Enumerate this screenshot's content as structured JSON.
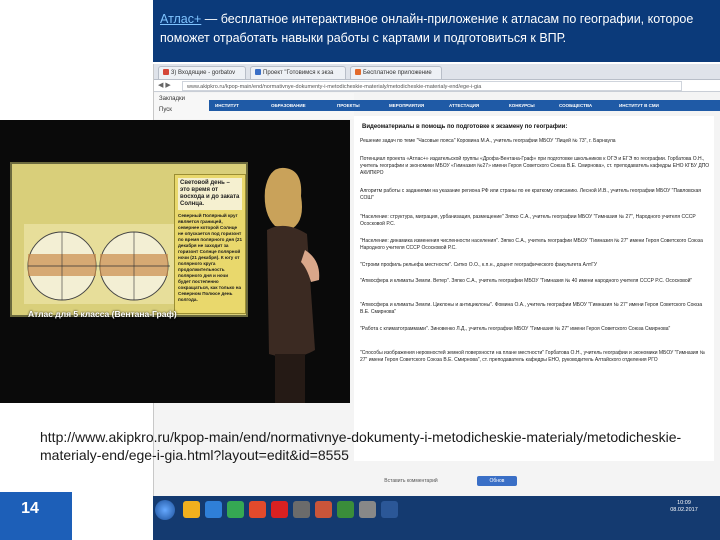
{
  "slide": {
    "header_link": "Атлас+",
    "header_text": " — бесплатное интерактивное онлайн-приложение к атласам по географии, которое поможет отработать навыки работы с картами и подготовиться к ВПР.",
    "slide_number": "14",
    "caption_url": "http://www.akipkro.ru/kpop-main/end/normativnye-dokumenty-i-metodicheskie-materialy/metodicheskie-materialy-end/ege-i-gia.html?layout=edit&id=8555",
    "colors": {
      "header_bg": "#0b3a7a",
      "link": "#7fc3ff",
      "accent": "#1d5fb8"
    }
  },
  "browser": {
    "tabs": [
      {
        "label": "3) Входящие - gorbatov",
        "fav_color": "#d44638"
      },
      {
        "label": "Проект \"Готовимся к экза",
        "fav_color": "#3a6fc6"
      },
      {
        "label": "Бесплатное приложение",
        "fav_color": "#e36b2c"
      }
    ],
    "url": "www.akipkro.ru/kpop-main/end/normativnye-dokumenty-i-metodicheskie-materialy/metodicheskie-materialy-end/ege-i-gia",
    "bookmarks": [
      "Закладки",
      "Пуск"
    ],
    "nav_items": [
      "ИНСТИТУТ",
      "ОБРАЗОВАНИЕ",
      "ПРОЕКТЫ",
      "МЕРОПРИЯТИЯ",
      "АТТЕСТАЦИЯ",
      "КОНКУРСЫ",
      "СООБЩЕСТВА",
      "ИНСТИТУТ В СМИ"
    ],
    "content_heading": "Видеоматериалы в помощь по подготовке к экзамену по географии:",
    "references": [
      "Решение задач по теме \"Часовые пояса\" Коровина М.А., учитель географии МБОУ \"Лицей № 73\", г. Барнаула",
      "Потенциал проекта «Атлас+» издательской группы «Дрофа-Вентана-Граф» при подготовке школьников к ОГЭ и ЕГЭ по географии. Горбатова О.Н., учитель географии и экономики МБОУ «Гимназия №27» имени Героя Советского Союза В.Е. Смирнова», ст. преподаватель кафедры ЕНО КГБУ ДПО АКИПКРО",
      "Алгоритм работы с заданиями на указание региона РФ или страны по ее краткому описанию. Лесной И.В., учитель географии МБОУ \"Павловская СОШ\"",
      "\"Население: структура, миграция, урбанизация, размещение\" Зяпко С.А., учитель географии МБОУ \"Гимназия № 27\", Народного учителя СССР Ососковой Р.С.",
      "\"Население: динамика изменения численности населения\". Зяпко С.А., учитель географии МБОУ \"Гимназия № 27\" имени Героя Советского Союза Народного учителя СССР Ососковой Р.С.",
      "\"Строим профиль рельефа местности\". Ситко О.О., к.п.н., доцент географического факультета АлтГУ",
      "\"Атмосфера и климаты Земли. Ветер\". Зяпко С.А., учитель географии МБОУ \"Гимназия № 40 имени народного учителя СССР Р.С. Ососковой\"",
      "\"Атмосфера и климаты Земли. Циклоны и антициклоны\". Фомина О.А., учитель географии МБОУ \"Гимназия № 27\" имени Героя Советского Союза В.Е. Смирнова\"",
      "\"Работа с климатограммами\". Зиновенко Л.Д., учитель географии МБОУ \"Гимназия № 27\" имени Героя Советского Союза Смирнова\"",
      "\"Способы изображения неровностей земной поверхности на плане местности\" Горбатова О.Н., учитель географии и экономики МБОУ \"Гимназия № 27\" имени Героя Советского Союза В.Е. Смирнова\", ст. преподаватель кафедры ЕНО, руководитель Алтайского отделения РГО"
    ],
    "comment_label": "Вставить комментарий",
    "refresh_label": "Обнов"
  },
  "video": {
    "atlas_caption": "Атлас для 5 класса (Вентана-Граф)",
    "panel_title": "Световой день – это время от восхода и до заката Солнца.",
    "panel_body": "Северный Полярный круг является границей, севернее которой Солнце не опускается под горизонт по время полярного дня (21 декабря не заходит за горизонт Солнце полярной ночи (21 декабря). К югу от полярного круга продолжительность полярного дня и ночи будет постепенно сокращаться, как только на Северном Полюсе день полгода."
  },
  "taskbar": {
    "clock_time": "10:09",
    "clock_date": "08.02.2017",
    "icon_colors": [
      "#f2b01e",
      "#2f7fd8",
      "#35a853",
      "#e24a2c",
      "#d92121",
      "#6b6b6b",
      "#c9553a",
      "#3a8d3a",
      "#888888",
      "#2b5797"
    ]
  }
}
